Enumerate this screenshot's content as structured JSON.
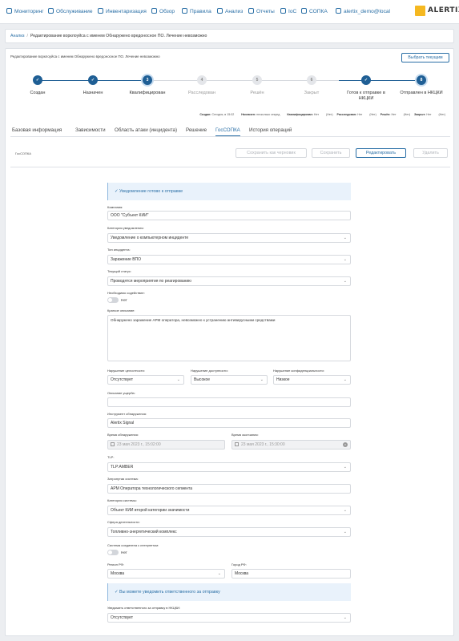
{
  "nav": {
    "items": [
      {
        "label": "Мониторинг",
        "icon": "monitor-icon"
      },
      {
        "label": "Обслуживание",
        "icon": "gear-icon"
      },
      {
        "label": "Инвентаризация",
        "icon": "inventory-icon"
      },
      {
        "label": "Обзор",
        "icon": "eye-icon"
      },
      {
        "label": "Правила",
        "icon": "wrench-icon"
      },
      {
        "label": "Анализ",
        "icon": "chart-icon"
      },
      {
        "label": "Отчеты",
        "icon": "report-icon"
      },
      {
        "label": "IoC",
        "icon": "ioc-icon"
      },
      {
        "label": "СОПКА",
        "icon": "shield-icon"
      },
      {
        "label": "alertix_demo@local",
        "icon": "user-icon"
      }
    ],
    "logo_text": "ALERTIX"
  },
  "breadcrumb": {
    "root": "Анализ",
    "current": "Редактирование ворклоуйса с именем Обнаружено вредоносное ПО. Лечение невозможно"
  },
  "incident": {
    "title": "Редактирование ворклоуйса с именем Обнаружено вредоносное ПО. Лечение невозможно",
    "select_button": "Выбрать текущим"
  },
  "stepper": {
    "steps": [
      {
        "num": "✓",
        "label": "Создан",
        "state": "done"
      },
      {
        "num": "✓",
        "label": "Назначен",
        "state": "done"
      },
      {
        "num": "3",
        "label": "Квалифицирован",
        "state": "current"
      },
      {
        "num": "4",
        "label": "Расследован",
        "state": "todo"
      },
      {
        "num": "5",
        "label": "Решён",
        "state": "todo"
      },
      {
        "num": "6",
        "label": "Закрыт",
        "state": "todo"
      },
      {
        "num": "✓",
        "label": "Готов к отправке в НКЦКИ",
        "state": "done"
      },
      {
        "num": "8",
        "label": "Отправлен в НКЦКИ",
        "state": "current"
      }
    ]
  },
  "meta": [
    {
      "k": "Создан:",
      "v": "Сегодня, в 15:02"
    },
    {
      "k": "Назначен:",
      "v": "несколько секунд"
    },
    {
      "k": "Квалифицирован:",
      "v": "Нет"
    },
    {
      "k": "(Нет)",
      "v": ""
    },
    {
      "k": "Расследован:",
      "v": "Нет"
    },
    {
      "k": "(Нет)",
      "v": ""
    },
    {
      "k": "Решён:",
      "v": "Нет"
    },
    {
      "k": "(Нет)",
      "v": ""
    },
    {
      "k": "Закрыт:",
      "v": "Нет"
    },
    {
      "k": "(Нет)",
      "v": ""
    }
  ],
  "tabs": [
    {
      "label": "Базовая информация"
    },
    {
      "label": "Зависимости"
    },
    {
      "label": "Область атаки (инцидента)"
    },
    {
      "label": "Решение"
    },
    {
      "label": "ГосСОПКА"
    },
    {
      "label": "История операций"
    }
  ],
  "toolbar": {
    "section": "ГосСОПКА",
    "save_draft": "Сохранить как черновик",
    "save": "Сохранить",
    "edit": "Редактировать",
    "delete": "Удалить"
  },
  "form": {
    "banner_ready": "Уведомление готово к отправке",
    "company_label": "Компания:",
    "company_value": "ООО \"Субъект КИИ\"",
    "category_label": "Категория уведомления:",
    "category_value": "Уведомление о компьютерном инциденте",
    "type_label": "Тип инцидента:",
    "type_value": "Заражение ВПО",
    "status_label": "Текущий статус:",
    "status_value": "Проводятся мероприятия по реагированию",
    "assist_label": "Необходимо содействие:",
    "assist_value": "Нет",
    "desc_label": "Краткое описание:",
    "desc_value": "Обнаружено заражение АРМ оператора, невозможно к устранению антивирусными средствами",
    "integrity_label": "Нарушение целостности:",
    "integrity_value": "Отсутствует",
    "availability_label": "Нарушение доступности:",
    "availability_value": "Высокое",
    "confidentiality_label": "Нарушение конфиденциальности:",
    "confidentiality_value": "Низкое",
    "damage_label": "Описание ущерба:",
    "damage_value": "",
    "tool_label": "Инструмент обнаружения:",
    "tool_value": "Alertix Signal",
    "detect_label": "Время обнаружения:",
    "detect_value": "23 мая 2023 г., 15:02:00",
    "end_label": "Время окончания:",
    "end_value": "23 мая 2023 г., 15:30:00",
    "tlp_label": "TLP:",
    "tlp_value": "TLP:AMBER",
    "system_label": "Затронутая система:",
    "system_value": "АРМ Оператора технологического сегмента",
    "syscat_label": "Категория системы:",
    "syscat_value": "Объект КИИ второй категории значимости",
    "sphere_label": "Сфера деятельности:",
    "sphere_value": "Топливно-энергетический комплекс",
    "internet_label": "Система соединена с интернетом:",
    "internet_value": "Нет",
    "region_label": "Регион РФ:",
    "region_value": "Москва",
    "city_label": "Город РФ:",
    "city_value": "Москва",
    "banner_notify": "Вы можете уведомить ответственного за отправку",
    "notify_label": "Уведомить ответственного за отправку в НКЦКИ:",
    "notify_value": "Отсутствует"
  },
  "colors": {
    "accent": "#2a6fa6",
    "step": "#1f5f95",
    "logo": "#f5b820"
  }
}
